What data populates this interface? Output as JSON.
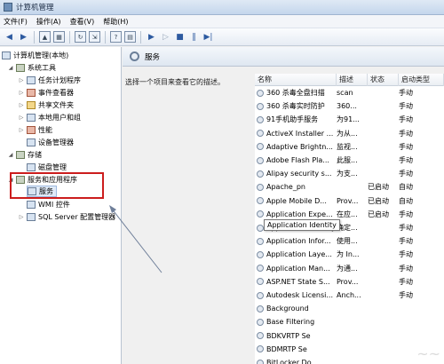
{
  "window": {
    "title": "计算机管理"
  },
  "menu": {
    "items": [
      "文件(F)",
      "操作(A)",
      "查看(V)",
      "帮助(H)"
    ]
  },
  "tree": {
    "root": "计算机管理(本地)",
    "system_tools": "系统工具",
    "task_scheduler": "任务计划程序",
    "event_viewer": "事件查看器",
    "shared_folders": "共享文件夹",
    "local_users": "本地用户和组",
    "performance": "性能",
    "device_manager": "设备管理器",
    "storage": "存储",
    "disk_management": "磁盘管理",
    "services_apps": "服务和应用程序",
    "services": "服务",
    "wmi": "WMI 控件",
    "sql_server": "SQL Server 配置管理器"
  },
  "services_panel": {
    "title": "服务",
    "description_prompt": "选择一个项目来查看它的描述。",
    "columns": {
      "name": "名称",
      "description": "描述",
      "status": "状态",
      "startup": "启动类型"
    },
    "rows": [
      {
        "name": "360 杀毒全盘扫描",
        "description": "scan",
        "status": "",
        "startup": "手动"
      },
      {
        "name": "360 杀毒实时防护",
        "description": "360...",
        "status": "",
        "startup": "手动"
      },
      {
        "name": "91手机助手服务",
        "description": "为91...",
        "status": "",
        "startup": "手动"
      },
      {
        "name": "ActiveX Installer ...",
        "description": "为从...",
        "status": "",
        "startup": "手动"
      },
      {
        "name": "Adaptive Brightn...",
        "description": "监视...",
        "status": "",
        "startup": "手动"
      },
      {
        "name": "Adobe Flash Pla...",
        "description": "此服...",
        "status": "",
        "startup": "手动"
      },
      {
        "name": "Alipay security s...",
        "description": "为支...",
        "status": "",
        "startup": "手动"
      },
      {
        "name": "Apache_pn",
        "description": "",
        "status": "已启动",
        "startup": "自动"
      },
      {
        "name": "Apple Mobile D...",
        "description": "Prov...",
        "status": "已启动",
        "startup": "自动"
      },
      {
        "name": "Application Expe...",
        "description": "在应...",
        "status": "已启动",
        "startup": "手动"
      },
      {
        "name": "Application Identity",
        "description": "确定...",
        "status": "",
        "startup": "手动"
      },
      {
        "name": "Application Infor...",
        "description": "使用...",
        "status": "",
        "startup": "手动"
      },
      {
        "name": "Application Laye...",
        "description": "为 In...",
        "status": "",
        "startup": "手动"
      },
      {
        "name": "Application Man...",
        "description": "为通...",
        "status": "",
        "startup": "手动"
      },
      {
        "name": "ASP.NET State S...",
        "description": "Prov...",
        "status": "",
        "startup": "手动"
      },
      {
        "name": "Autodesk Licensi...",
        "description": "Anch...",
        "status": "",
        "startup": "手动"
      },
      {
        "name": "Background",
        "description": "",
        "status": "",
        "startup": ""
      },
      {
        "name": "Base Filtering",
        "description": "",
        "status": "",
        "startup": ""
      },
      {
        "name": "BDKVRTP Se",
        "description": "",
        "status": "",
        "startup": ""
      },
      {
        "name": "BDMRTP Se",
        "description": "",
        "status": "",
        "startup": ""
      },
      {
        "name": "BitLocker Do",
        "description": "",
        "status": "",
        "startup": ""
      }
    ],
    "tooltip": "Application Identity"
  },
  "colors": {
    "highlight": "#cc1d1d",
    "selection": "#dfeaf8"
  }
}
